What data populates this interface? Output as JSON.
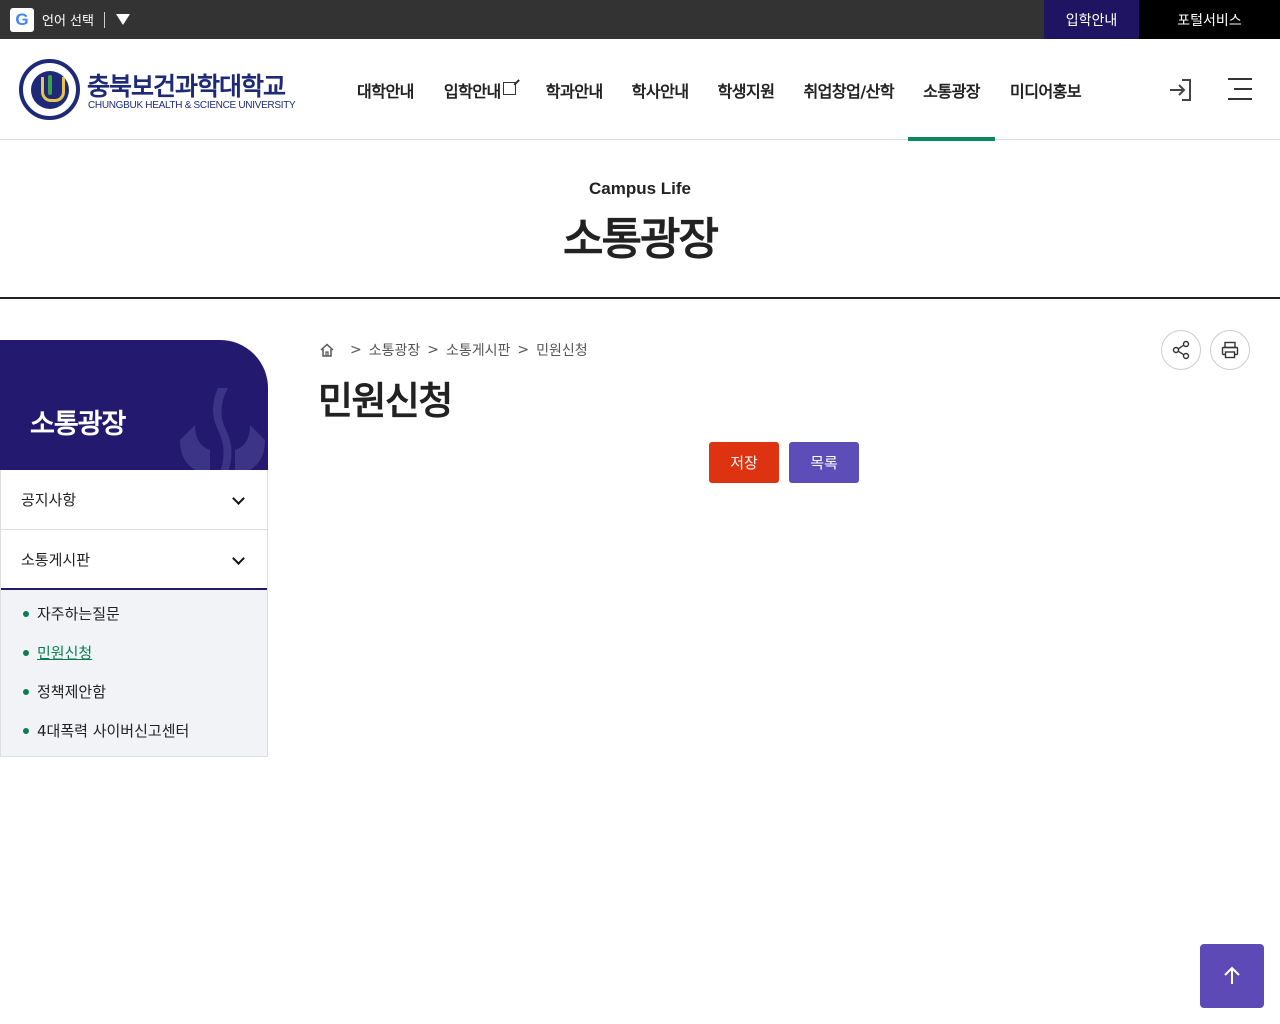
{
  "topbar": {
    "lang_label": "언어 선택",
    "admission_link": "입학안내",
    "portal_link": "포털서비스"
  },
  "header": {
    "logo_kr": "충북보건과학대학교",
    "logo_en": "CHUNGBUK HEALTH & SCIENCE UNIVERSITY",
    "nav": [
      {
        "label": "대학안내"
      },
      {
        "label": "입학안내"
      },
      {
        "label": "학과안내"
      },
      {
        "label": "학사안내"
      },
      {
        "label": "학생지원"
      },
      {
        "label": "취업창업/산학"
      },
      {
        "label": "소통광장",
        "active": true
      },
      {
        "label": "미디어홍보"
      }
    ]
  },
  "visual": {
    "subtitle": "Campus Life",
    "title": "소통광장"
  },
  "sidebar": {
    "title": "소통광장",
    "items": [
      {
        "label": "공지사항"
      },
      {
        "label": "소통게시판"
      }
    ],
    "sub_items": [
      {
        "label": "자주하는질문"
      },
      {
        "label": "민원신청",
        "active": true
      },
      {
        "label": "정책제안함"
      },
      {
        "label": "4대폭력 사이버신고센터"
      }
    ]
  },
  "breadcrumb": {
    "items": [
      "소통광장",
      "소통게시판",
      "민원신청"
    ],
    "separator": ">"
  },
  "content": {
    "title": "민원신청",
    "save_label": "저장",
    "list_label": "목록"
  },
  "colors": {
    "brand_navy": "#23196e",
    "accent_green": "#0a8a5a",
    "save_red": "#dd3311",
    "list_purple": "#5d4db8"
  },
  "icons": [
    "google-icon",
    "dropdown-arrow-icon",
    "external-link-icon",
    "login-icon",
    "menu-icon",
    "home-icon",
    "share-icon",
    "print-icon",
    "chevron-down-icon",
    "arrow-up-icon"
  ]
}
